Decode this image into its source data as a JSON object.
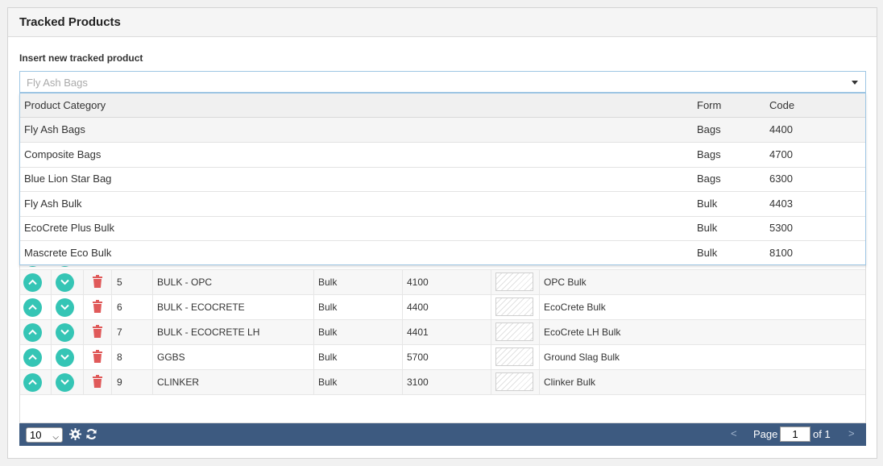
{
  "panel": {
    "title": "Tracked Products"
  },
  "insert": {
    "label": "Insert new tracked product",
    "selected": "Fly Ash Bags"
  },
  "dropdown": {
    "columns": {
      "category": "Product Category",
      "form": "Form",
      "code": "Code"
    },
    "rows": [
      {
        "category": "Fly Ash Bags",
        "form": "Bags",
        "code": "4400"
      },
      {
        "category": "Composite Bags",
        "form": "Bags",
        "code": "4700"
      },
      {
        "category": "Blue Lion Star Bag",
        "form": "Bags",
        "code": "6300"
      },
      {
        "category": "Fly Ash Bulk",
        "form": "Bulk",
        "code": "4403"
      },
      {
        "category": "EcoCrete Plus Bulk",
        "form": "Bulk",
        "code": "5300"
      },
      {
        "category": "Mascrete Eco Bulk",
        "form": "Bulk",
        "code": "8100"
      }
    ]
  },
  "table": {
    "rows": [
      {
        "order": "5",
        "product": "BULK - OPC",
        "form": "Bulk",
        "code": "4100",
        "category": "OPC Bulk"
      },
      {
        "order": "6",
        "product": "BULK - ECOCRETE",
        "form": "Bulk",
        "code": "4400",
        "category": "EcoCrete Bulk"
      },
      {
        "order": "7",
        "product": "BULK - ECOCRETE LH",
        "form": "Bulk",
        "code": "4401",
        "category": "EcoCrete LH Bulk"
      },
      {
        "order": "8",
        "product": "GGBS",
        "form": "Bulk",
        "code": "5700",
        "category": "Ground Slag Bulk"
      },
      {
        "order": "9",
        "product": "CLINKER",
        "form": "Bulk",
        "code": "3100",
        "category": "Clinker Bulk"
      }
    ]
  },
  "pager": {
    "page_size": "10",
    "page_label": "Page",
    "page_value": "1",
    "of_label": "of 1",
    "prev": "<",
    "next": ">"
  },
  "colors": {
    "action_circle": "#35c5b5",
    "delete_icon": "#e05a5a",
    "pager_bg": "#3d5a80"
  }
}
